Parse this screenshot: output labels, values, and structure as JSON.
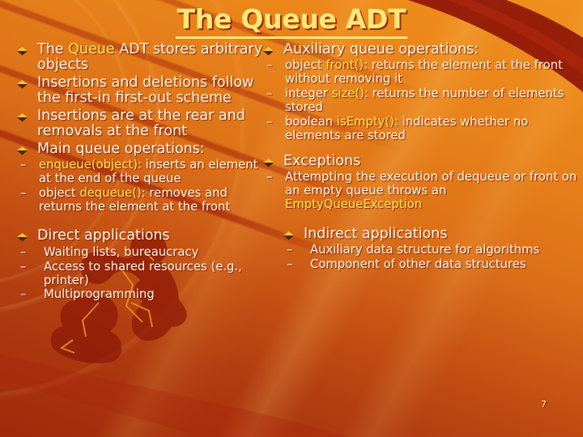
{
  "slide": {
    "title": "The Queue ADT",
    "number": "7",
    "colors": {
      "title": "#ffe77a",
      "body_text": "#fdf6e6",
      "code_highlight": "#ffe55c",
      "bg_orange": "#f0901c",
      "bg_red": "#9e2a0b",
      "accent_dark_red": "#96160 8"
    },
    "bullet_icon": "diamond-bullet-icon",
    "subbullet_icon": "en-dash-icon"
  },
  "left_column": {
    "bullets": [
      {
        "pre": "The ",
        "code": "Queue",
        "post": " ADT stores arbitrary objects"
      },
      {
        "pre": "Insertions and deletions follow the first-in first-out scheme",
        "code": "",
        "post": ""
      },
      {
        "pre": "Insertions are at the rear and removals at the front",
        "code": "",
        "post": ""
      },
      {
        "pre": "Main queue operations:",
        "code": "",
        "post": ""
      }
    ],
    "main_ops": {
      "items": [
        {
          "pre": "",
          "code": "enqueue(object)",
          "post": ": inserts an element at the end of the queue"
        },
        {
          "pre": "object ",
          "code": "dequeue()",
          "post": ": removes and returns the element at the front"
        }
      ]
    },
    "direct": {
      "heading": "Direct applications",
      "items": [
        "Waiting lists, bureaucracy",
        "Access to shared resources (e.g., printer)",
        "Multiprogramming"
      ]
    }
  },
  "right_column": {
    "auxiliary": {
      "heading": "Auxiliary queue operations:",
      "items": [
        {
          "pre": "object ",
          "code": "front()",
          "post": ": returns the element at the front without removing it"
        },
        {
          "pre": "integer ",
          "code": "size()",
          "post": ": returns the number of elements stored"
        },
        {
          "pre": "boolean ",
          "code": "isEmpty()",
          "post": ": indicates whether no elements are stored"
        }
      ]
    },
    "exceptions": {
      "heading": "Exceptions",
      "items": [
        {
          "pre": "Attempting the execution of dequeue or front on an empty queue throws an ",
          "code": "EmptyQueueException",
          "post": ""
        }
      ]
    },
    "indirect": {
      "heading": "Indirect applications",
      "items": [
        "Auxiliary data structure for algorithms",
        "Component of other data structures"
      ]
    }
  }
}
